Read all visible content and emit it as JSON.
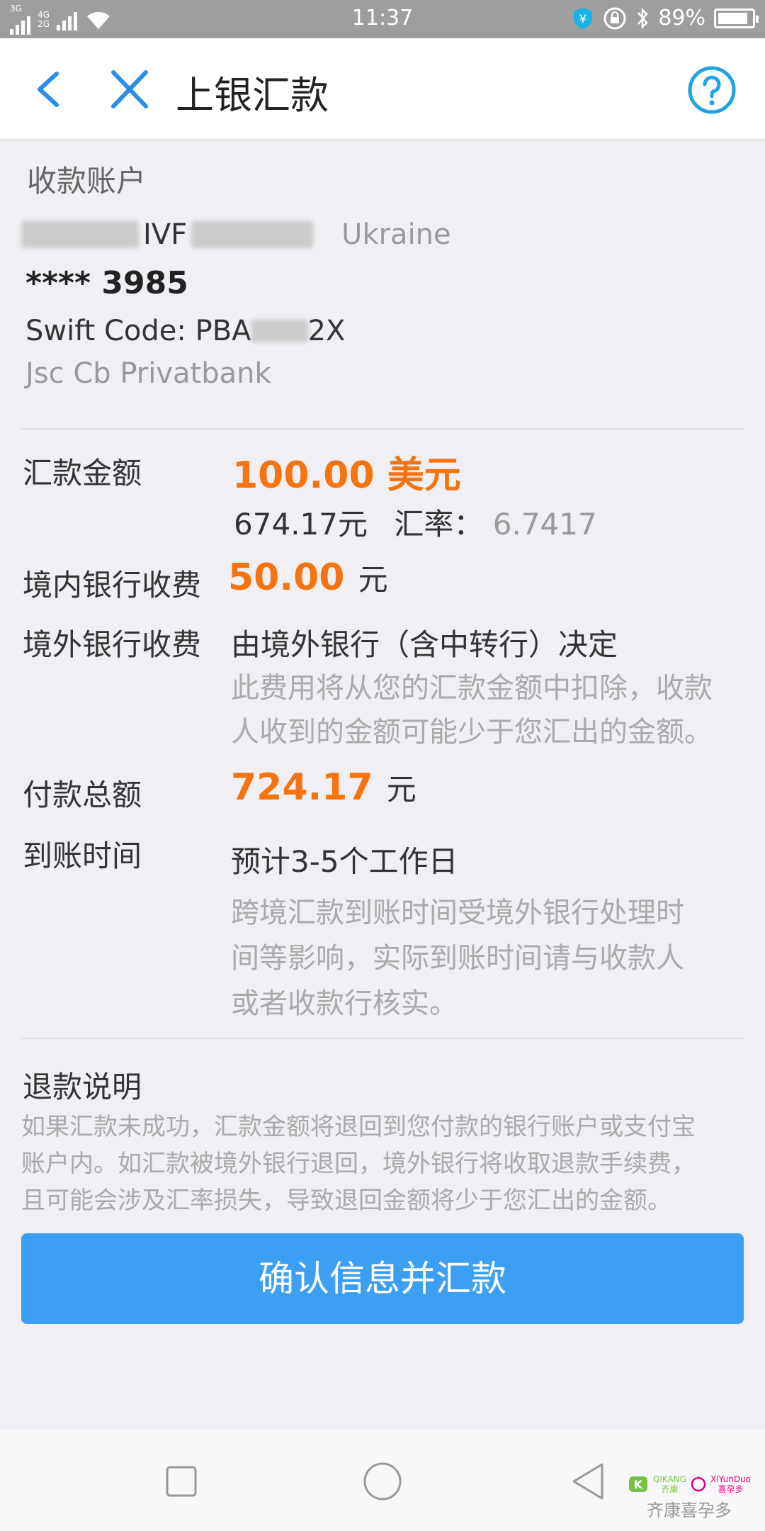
{
  "status_bar": {
    "network_left": "3G",
    "network_mid": "4G",
    "network_mid2": "2G",
    "time": "11:37",
    "battery": "89%",
    "battery_level": 0.89
  },
  "nav": {
    "title": "上银汇款"
  },
  "recipient": {
    "section_label": "收款账户",
    "name_part": "IVF",
    "country": "Ukraine",
    "account": "**** 3985",
    "swift_prefix": "Swift Code: PBA",
    "swift_suffix": "2X",
    "bank": "Jsc Cb Privatbank"
  },
  "details": {
    "amount_label": "汇款金额",
    "amount_value": "100.00 美元",
    "cny_value": "674.17元",
    "rate_label": "汇率：",
    "rate_value": "6.7417",
    "domestic_fee_label": "境内银行收费",
    "domestic_fee_value": "50.00",
    "domestic_fee_unit": "元",
    "foreign_fee_label": "境外银行收费",
    "foreign_fee_value": "由境外银行（含中转行）决定",
    "foreign_fee_note_1": "此费用将从您的汇款金额中扣除，收款",
    "foreign_fee_note_2": "人收到的金额可能少于您汇出的金额。",
    "total_label": "付款总额",
    "total_value": "724.17",
    "total_unit": "元",
    "arrival_label": "到账时间",
    "arrival_value": "预计3-5个工作日",
    "arrival_note_1": "跨境汇款到账时间受境外银行处理时",
    "arrival_note_2": "间等影响，实际到账时间请与收款人",
    "arrival_note_3": "或者收款行核实。"
  },
  "refund": {
    "title": "退款说明",
    "line_1": "如果汇款未成功，汇款金额将退回到您付款的银行账户或支付宝",
    "line_2": "账户内。如汇款被境外银行退回，境外银行将收取退款手续费，",
    "line_3": "且可能会涉及汇率损失，导致退回金额将少于您汇出的金额。"
  },
  "confirm_button": "确认信息并汇款",
  "watermark": {
    "brand_1": "QIKANG",
    "brand_1_cn": "齐康",
    "brand_2": "XiYunDuo",
    "brand_2_cn": "喜孕多",
    "text": "齐康喜孕多"
  },
  "colors": {
    "accent_blue": "#3d9ff3",
    "amount_orange": "#f5740f",
    "nav_icon_blue": "#2a8ee8"
  }
}
